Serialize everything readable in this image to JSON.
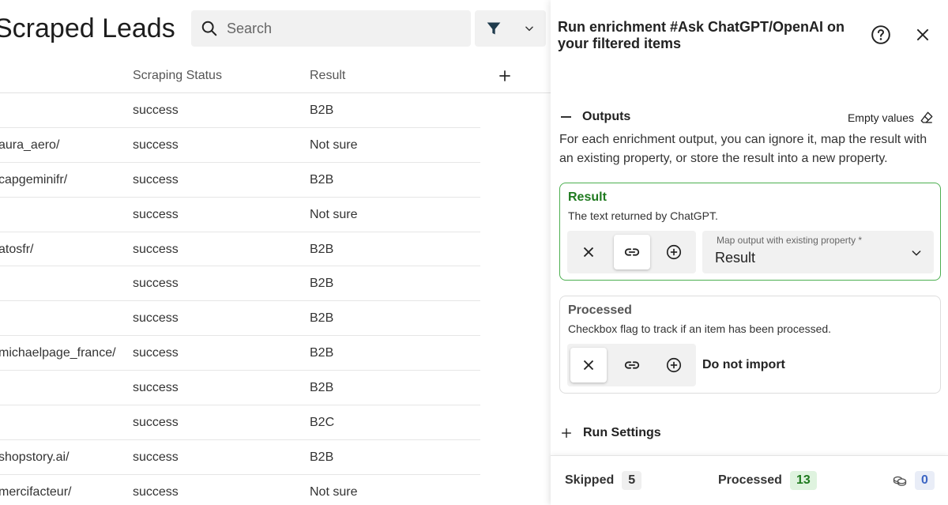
{
  "header": {
    "title": "Scraped Leads",
    "search_placeholder": "Search"
  },
  "table": {
    "columns": [
      "Scraping Status",
      "Result"
    ],
    "rows": [
      {
        "name": "",
        "status": "success",
        "result": "B2B"
      },
      {
        "name": "aura_aero/",
        "status": "success",
        "result": "Not sure"
      },
      {
        "name": "capgeminifr/",
        "status": "success",
        "result": "B2B"
      },
      {
        "name": "",
        "status": "success",
        "result": "Not sure"
      },
      {
        "name": "atosfr/",
        "status": "success",
        "result": "B2B"
      },
      {
        "name": "",
        "status": "success",
        "result": "B2B"
      },
      {
        "name": "",
        "status": "success",
        "result": "B2B"
      },
      {
        "name": "michaelpage_france/",
        "status": "success",
        "result": "B2B"
      },
      {
        "name": "",
        "status": "success",
        "result": "B2B"
      },
      {
        "name": "",
        "status": "success",
        "result": "B2C"
      },
      {
        "name": "shopstory.ai/",
        "status": "success",
        "result": "B2B"
      },
      {
        "name": "mercifacteur/",
        "status": "success",
        "result": "Not sure"
      }
    ]
  },
  "panel": {
    "title": "Run enrichment #Ask ChatGPT/OpenAI on your filtered items",
    "outputs": {
      "heading": "Outputs",
      "empty_values": "Empty values",
      "description": "For each enrichment output, you can ignore it, map the result with an existing property, or store the result into a new property."
    },
    "result_card": {
      "title": "Result",
      "description": "The text returned by ChatGPT.",
      "map_label": "Map output with existing property *",
      "map_value": "Result"
    },
    "processed_card": {
      "title": "Processed",
      "description": "Checkbox flag to track if an item has been processed.",
      "state": "Do not import"
    },
    "run_settings": "Run Settings",
    "footer": {
      "skipped_label": "Skipped",
      "skipped_count": "5",
      "processed_label": "Processed",
      "processed_count": "13",
      "credits_count": "0"
    }
  },
  "colors": {
    "accent_green": "#4caf50",
    "result_title": "#1f7a1f",
    "credits_blue": "#3d66c4",
    "filter_icon": "#1f3b4d"
  },
  "icons": [
    "search-icon",
    "filter-icon",
    "chevron-down-icon",
    "plus-icon",
    "help-icon",
    "close-icon",
    "eraser-icon",
    "x-icon",
    "link-icon",
    "add-circle-icon",
    "coins-icon"
  ]
}
